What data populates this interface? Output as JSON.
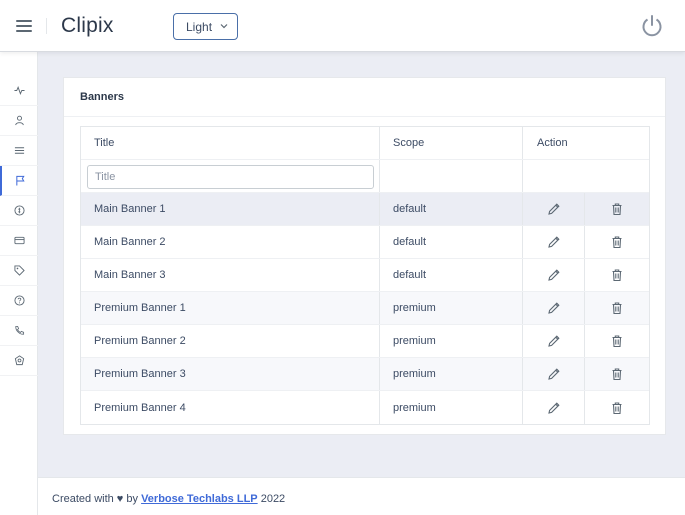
{
  "header": {
    "brand": "Clipix",
    "theme_value": "Light"
  },
  "sidebar": {
    "items": [
      {
        "icon": "activity-icon"
      },
      {
        "icon": "user-icon"
      },
      {
        "icon": "list-icon"
      },
      {
        "icon": "flag-icon",
        "active": true
      },
      {
        "icon": "coin-icon"
      },
      {
        "icon": "card-icon"
      },
      {
        "icon": "tag-icon"
      },
      {
        "icon": "help-icon"
      },
      {
        "icon": "phone-icon"
      },
      {
        "icon": "badge-icon"
      }
    ]
  },
  "card": {
    "title": "Banners",
    "columns": [
      "Title",
      "Scope",
      "Action"
    ],
    "filter_placeholder": "Title",
    "rows": [
      {
        "title": "Main Banner 1",
        "scope": "default"
      },
      {
        "title": "Main Banner 2",
        "scope": "default"
      },
      {
        "title": "Main Banner 3",
        "scope": "default"
      },
      {
        "title": "Premium Banner 1",
        "scope": "premium"
      },
      {
        "title": "Premium Banner 2",
        "scope": "premium"
      },
      {
        "title": "Premium Banner 3",
        "scope": "premium"
      },
      {
        "title": "Premium Banner 4",
        "scope": "premium"
      }
    ]
  },
  "footer": {
    "prefix": "Created with ♥ by",
    "company": "Verbose Techlabs LLP",
    "year": "2022"
  },
  "colors": {
    "accent": "#3f6ad8",
    "background": "#ebedf4"
  }
}
